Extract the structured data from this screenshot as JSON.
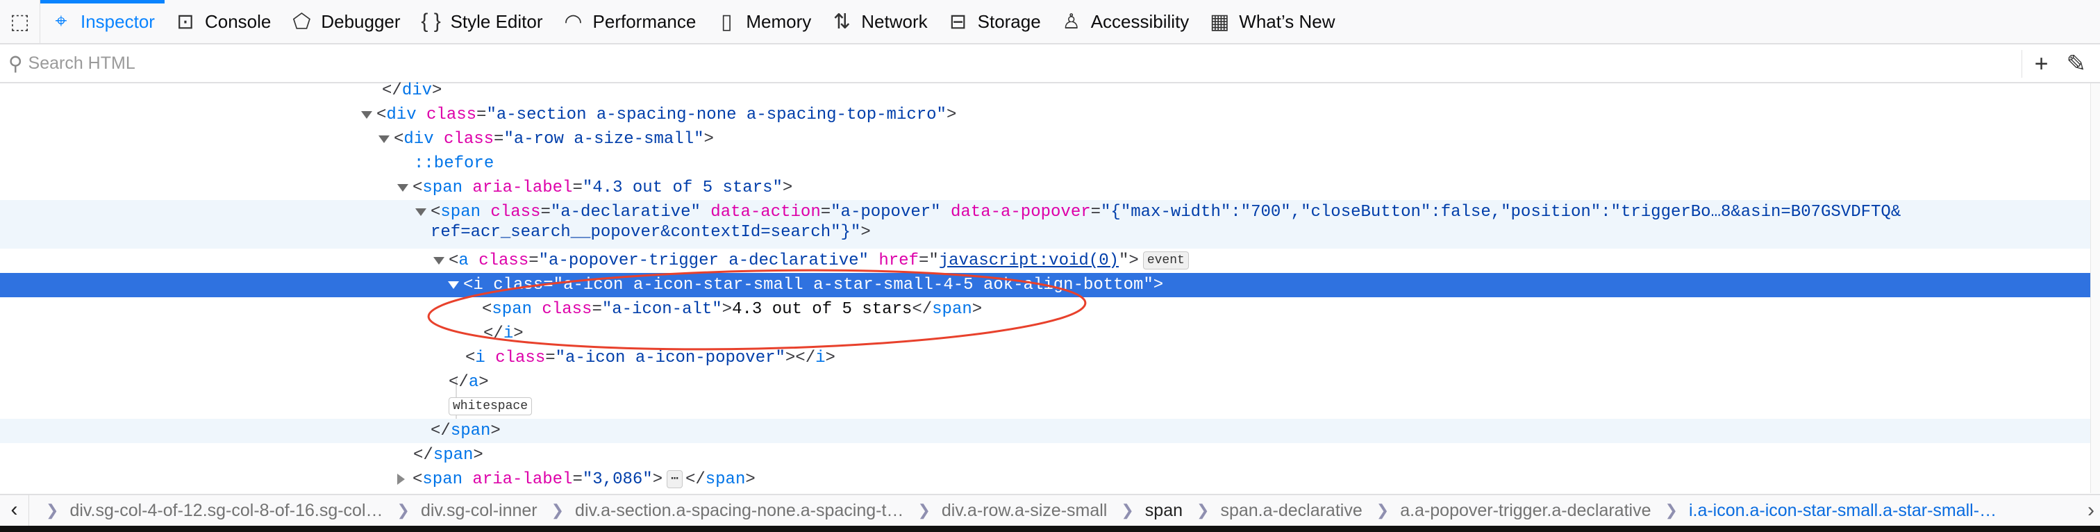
{
  "toolbar": {
    "picker_icon": "element-picker-icon",
    "tabs": [
      {
        "label": "Inspector",
        "icon": "inspector-icon",
        "glyph": "⌖",
        "active": true
      },
      {
        "label": "Console",
        "icon": "console-icon",
        "glyph": "⊡"
      },
      {
        "label": "Debugger",
        "icon": "debugger-icon",
        "glyph": "⬠"
      },
      {
        "label": "Style Editor",
        "icon": "style-editor-icon",
        "glyph": "{ }"
      },
      {
        "label": "Performance",
        "icon": "performance-icon",
        "glyph": "◠"
      },
      {
        "label": "Memory",
        "icon": "memory-icon",
        "glyph": "▯"
      },
      {
        "label": "Network",
        "icon": "network-icon",
        "glyph": "⇅"
      },
      {
        "label": "Storage",
        "icon": "storage-icon",
        "glyph": "⊟"
      },
      {
        "label": "Accessibility",
        "icon": "accessibility-icon",
        "glyph": "♙"
      },
      {
        "label": "What’s New",
        "icon": "gift-icon",
        "glyph": "▦"
      }
    ]
  },
  "search": {
    "placeholder": "Search HTML",
    "value": ""
  },
  "markup": {
    "lines": [
      {
        "x": 0,
        "tokens": [
          [
            "p",
            "</"
          ],
          [
            "t",
            "div"
          ],
          [
            "p",
            ">"
          ]
        ]
      },
      {
        "twisty": "open",
        "tokens": [
          [
            "p",
            "<"
          ],
          [
            "t",
            "div"
          ],
          [
            "p",
            " "
          ],
          [
            "a",
            "class"
          ],
          [
            "p",
            "="
          ],
          [
            "v",
            "\"a-section a-spacing-none a-spacing-top-micro\""
          ],
          [
            "p",
            ">"
          ]
        ]
      },
      {
        "twisty": "open",
        "tokens": [
          [
            "p",
            "<"
          ],
          [
            "t",
            "div"
          ],
          [
            "p",
            " "
          ],
          [
            "a",
            "class"
          ],
          [
            "p",
            "="
          ],
          [
            "v",
            "\"a-row a-size-small\""
          ],
          [
            "p",
            ">"
          ]
        ]
      },
      {
        "tokens": [
          [
            "ps",
            "::before"
          ]
        ]
      },
      {
        "twisty": "open",
        "tokens": [
          [
            "p",
            "<"
          ],
          [
            "t",
            "span"
          ],
          [
            "p",
            " "
          ],
          [
            "a",
            "aria-label"
          ],
          [
            "p",
            "="
          ],
          [
            "v",
            "\"4.3 out of 5 stars\""
          ],
          [
            "p",
            ">"
          ]
        ]
      },
      {
        "twisty": "open",
        "highlight": true,
        "tokens": [
          [
            "p",
            "<"
          ],
          [
            "t",
            "span"
          ],
          [
            "p",
            " "
          ],
          [
            "a",
            "class"
          ],
          [
            "p",
            "="
          ],
          [
            "v",
            "\"a-declarative\""
          ],
          [
            "p",
            " "
          ],
          [
            "a",
            "data-action"
          ],
          [
            "p",
            "="
          ],
          [
            "v",
            "\"a-popover\""
          ],
          [
            "p",
            " "
          ],
          [
            "a",
            "data-a-popover"
          ],
          [
            "p",
            "="
          ],
          [
            "v",
            "\"{\"max-width\":\"700\",\"closeButton\":false,\"position\":\"triggerBo…8&asin=B07GSVDFTQ&"
          ]
        ],
        "continuation": [
          [
            "v",
            "ref=acr_search__popover&contextId=search\"}\""
          ],
          [
            "p",
            ">"
          ]
        ]
      },
      {
        "twisty": "open",
        "tokens": [
          [
            "p",
            "<"
          ],
          [
            "t",
            "a"
          ],
          [
            "p",
            " "
          ],
          [
            "a",
            "class"
          ],
          [
            "p",
            "="
          ],
          [
            "v",
            "\"a-popover-trigger a-declarative\""
          ],
          [
            "p",
            " "
          ],
          [
            "a",
            "href"
          ],
          [
            "p",
            "="
          ],
          [
            "p",
            "\""
          ],
          [
            "v link",
            "javascript:void(0)"
          ],
          [
            "p",
            "\">"
          ]
        ],
        "badge": "event"
      },
      {
        "twisty": "open",
        "selected": true,
        "tokens": [
          [
            "p",
            "<"
          ],
          [
            "t",
            "i"
          ],
          [
            "p",
            " "
          ],
          [
            "a",
            "class"
          ],
          [
            "p",
            "="
          ],
          [
            "v",
            "\"a-icon a-icon-star-small a-star-small-4-5 aok-align-bottom\""
          ],
          [
            "p",
            ">"
          ]
        ]
      },
      {
        "tokens": [
          [
            "p",
            "<"
          ],
          [
            "t",
            "span"
          ],
          [
            "p",
            " "
          ],
          [
            "a",
            "class"
          ],
          [
            "p",
            "="
          ],
          [
            "v",
            "\"a-icon-alt\""
          ],
          [
            "p",
            ">"
          ],
          [
            "txt",
            "4.3 out of 5 stars"
          ],
          [
            "p",
            "</"
          ],
          [
            "t",
            "span"
          ],
          [
            "p",
            ">"
          ]
        ]
      },
      {
        "tokens": [
          [
            "p",
            "</"
          ],
          [
            "t",
            "i"
          ],
          [
            "p",
            ">"
          ]
        ]
      },
      {
        "tokens": [
          [
            "p",
            "<"
          ],
          [
            "t",
            "i"
          ],
          [
            "p",
            " "
          ],
          [
            "a",
            "class"
          ],
          [
            "p",
            "="
          ],
          [
            "v",
            "\"a-icon a-icon-popover\""
          ],
          [
            "p",
            "></"
          ],
          [
            "t",
            "i"
          ],
          [
            "p",
            ">"
          ]
        ]
      },
      {
        "tokens": [
          [
            "p",
            "</"
          ],
          [
            "t",
            "a"
          ],
          [
            "p",
            ">"
          ]
        ]
      },
      {
        "tokens": [],
        "badge_only": "whitespace"
      },
      {
        "highlight": true,
        "tokens": [
          [
            "p",
            "</"
          ],
          [
            "t",
            "span"
          ],
          [
            "p",
            ">"
          ]
        ]
      },
      {
        "tokens": [
          [
            "p",
            "</"
          ],
          [
            "t",
            "span"
          ],
          [
            "p",
            ">"
          ]
        ]
      },
      {
        "twisty": "closed",
        "tokens": [
          [
            "p",
            "<"
          ],
          [
            "t",
            "span"
          ],
          [
            "p",
            " "
          ],
          [
            "a",
            "aria-label"
          ],
          [
            "p",
            "="
          ],
          [
            "v",
            "\"3,086\""
          ],
          [
            "p",
            ">"
          ]
        ],
        "badge_inline": "⋯",
        "after": [
          [
            "p",
            "</"
          ],
          [
            "t",
            "span"
          ],
          [
            "p",
            ">"
          ]
        ]
      }
    ]
  },
  "breadcrumbs": [
    {
      "label": "div.sg-col-4-of-12.sg-col-8-of-16.sg-col…"
    },
    {
      "label": "div.sg-col-inner"
    },
    {
      "label": "div.a-section.a-spacing-none.a-spacing-t…"
    },
    {
      "label": "div.a-row.a-size-small"
    },
    {
      "label": "span",
      "style": "dark"
    },
    {
      "label": "span.a-declarative"
    },
    {
      "label": "a.a-popover-trigger.a-declarative"
    },
    {
      "label": "i.a-icon.a-icon-star-small.a-star-small-…",
      "current": true
    }
  ],
  "colors": {
    "accent": "#0a84ff",
    "selection": "#2f72e0",
    "annotation": "#e8412c"
  }
}
